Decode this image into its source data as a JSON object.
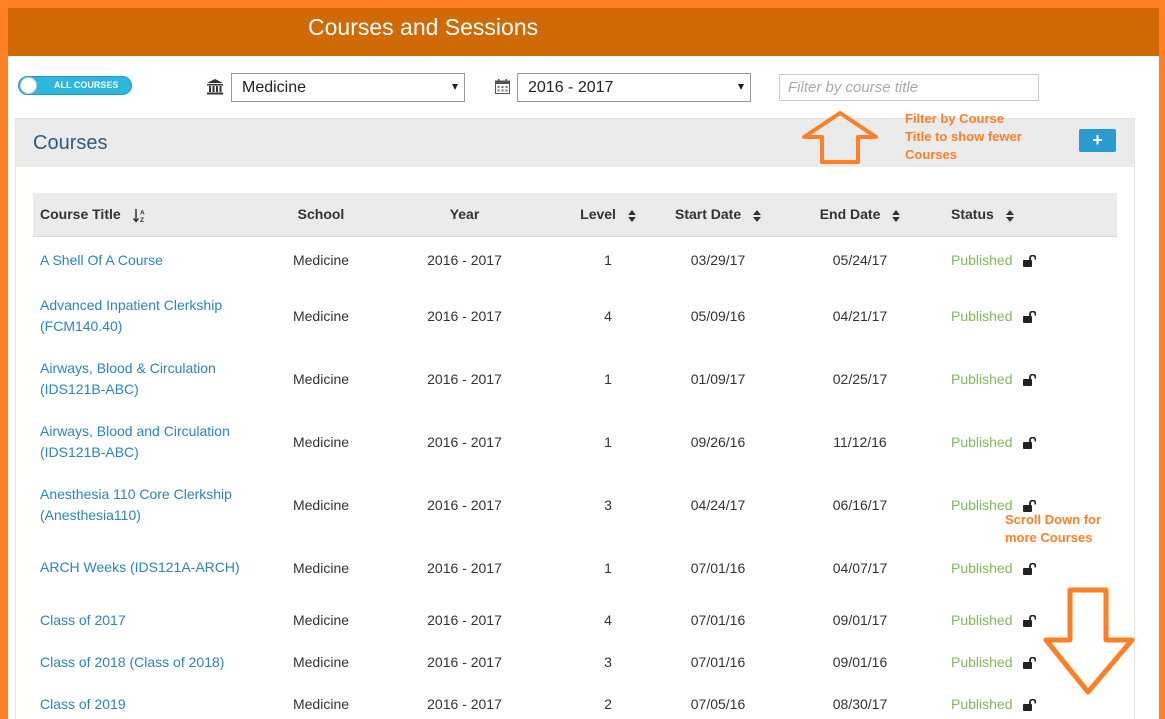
{
  "header": {
    "title": "Courses and Sessions"
  },
  "toolbar": {
    "toggle_label": "ALL COURSES",
    "school_icon": "institution-icon",
    "school_select": "Medicine",
    "year_icon": "calendar-icon",
    "year_select": "2016 - 2017",
    "filter_placeholder": "Filter by course title"
  },
  "panel": {
    "title": "Courses",
    "add_label": "+"
  },
  "table": {
    "headers": {
      "title": "Course Title",
      "school": "School",
      "year": "Year",
      "level": "Level",
      "start": "Start Date",
      "end": "End Date",
      "status": "Status"
    },
    "rows": [
      {
        "title": "A Shell Of A Course",
        "school": "Medicine",
        "year": "2016 - 2017",
        "level": "1",
        "start": "03/29/17",
        "end": "05/24/17",
        "status": "Published"
      },
      {
        "title": "Advanced Inpatient Clerkship (FCM140.40)",
        "school": "Medicine",
        "year": "2016 - 2017",
        "level": "4",
        "start": "05/09/16",
        "end": "04/21/17",
        "status": "Published"
      },
      {
        "title": "Airways, Blood & Circulation (IDS121B-ABC)",
        "school": "Medicine",
        "year": "2016 - 2017",
        "level": "1",
        "start": "01/09/17",
        "end": "02/25/17",
        "status": "Published"
      },
      {
        "title": "Airways, Blood and Circulation (IDS121B-ABC)",
        "school": "Medicine",
        "year": "2016 - 2017",
        "level": "1",
        "start": "09/26/16",
        "end": "11/12/16",
        "status": "Published"
      },
      {
        "title": "Anesthesia 110 Core Clerkship (Anesthesia110)",
        "school": "Medicine",
        "year": "2016 - 2017",
        "level": "3",
        "start": "04/24/17",
        "end": "06/16/17",
        "status": "Published"
      },
      {
        "title": "ARCH Weeks (IDS121A-ARCH)",
        "school": "Medicine",
        "year": "2016 - 2017",
        "level": "1",
        "start": "07/01/16",
        "end": "04/07/17",
        "status": "Published"
      },
      {
        "title": "Class of 2017",
        "school": "Medicine",
        "year": "2016 - 2017",
        "level": "4",
        "start": "07/01/16",
        "end": "09/01/17",
        "status": "Published"
      },
      {
        "title": "Class of 2018 (Class of 2018)",
        "school": "Medicine",
        "year": "2016 - 2017",
        "level": "3",
        "start": "07/01/16",
        "end": "09/01/16",
        "status": "Published"
      },
      {
        "title": "Class of 2019",
        "school": "Medicine",
        "year": "2016 - 2017",
        "level": "2",
        "start": "07/05/16",
        "end": "08/30/17",
        "status": "Published"
      }
    ]
  },
  "annotations": {
    "filter_note": [
      "Filter by Course",
      "Title to show fewer",
      "Courses"
    ],
    "scroll_note": [
      "Scroll Down for",
      "more Courses"
    ]
  },
  "colors": {
    "header": "#d06a06",
    "border": "#ff7f27",
    "link": "#2a86b4",
    "published": "#83b85a",
    "toggle": "#2eb6dc"
  }
}
